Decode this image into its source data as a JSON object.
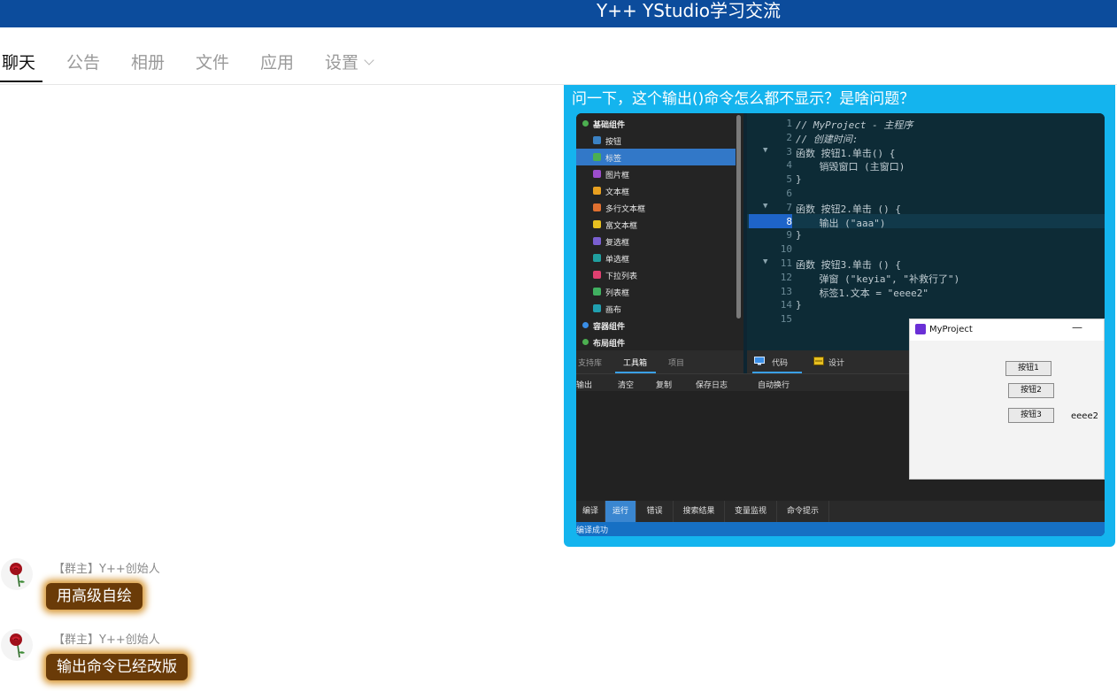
{
  "window": {
    "title": "Y++ YStudio学习交流"
  },
  "tabs": [
    {
      "label": "聊天",
      "active": true
    },
    {
      "label": "公告"
    },
    {
      "label": "相册"
    },
    {
      "label": "文件"
    },
    {
      "label": "应用"
    },
    {
      "label": "设置"
    }
  ],
  "question": {
    "text": "问一下，这个输出()命令怎么都不显示？是啥问题？",
    "screenshot": {
      "tree": [
        {
          "label": "基础组件",
          "group": true,
          "color": "#4caf50"
        },
        {
          "label": "按钮",
          "icon": "#3b82c4"
        },
        {
          "label": "标签",
          "icon": "#4caf50",
          "selected": true
        },
        {
          "label": "图片框",
          "icon": "#9c4dcc"
        },
        {
          "label": "文本框",
          "icon": "#e8a020"
        },
        {
          "label": "多行文本框",
          "icon": "#e07030"
        },
        {
          "label": "富文本框",
          "icon": "#e8c020"
        },
        {
          "label": "复选框",
          "icon": "#7a5fd0"
        },
        {
          "label": "单选框",
          "icon": "#20a0a0"
        },
        {
          "label": "下拉列表",
          "icon": "#e04070"
        },
        {
          "label": "列表框",
          "icon": "#40b060"
        },
        {
          "label": "画布",
          "icon": "#20a0b0"
        },
        {
          "label": "容器组件",
          "group": true,
          "color": "#3a8ee6"
        },
        {
          "label": "布局组件",
          "group": true,
          "color": "#4caf50"
        }
      ],
      "tree_tabs": [
        "支持库",
        "工具箱",
        "项目"
      ],
      "code_tabs": [
        "代码",
        "设计"
      ],
      "code_lines": [
        {
          "n": "1",
          "t": "// MyProject - 主程序"
        },
        {
          "n": "2",
          "t": "// 创建时间:"
        },
        {
          "n": "3",
          "t": "函数 按钮1.单击() {",
          "fold": "▼"
        },
        {
          "n": "4",
          "t": "    销毁窗口 (主窗口)"
        },
        {
          "n": "5",
          "t": "}"
        },
        {
          "n": "6",
          "t": ""
        },
        {
          "n": "7",
          "t": "函数 按钮2.单击 () {",
          "fold": "▼"
        },
        {
          "n": "8",
          "t": "    输出 (\"aaa\")",
          "current": true
        },
        {
          "n": "9",
          "t": "}"
        },
        {
          "n": "10",
          "t": ""
        },
        {
          "n": "11",
          "t": "函数 按钮3.单击 () {",
          "fold": "▼"
        },
        {
          "n": "12",
          "t": "    弹窗 (\"keyia\", \"补救行了\")"
        },
        {
          "n": "13",
          "t": "    标签1.文本 = \"eeee2\""
        },
        {
          "n": "14",
          "t": "}"
        },
        {
          "n": "15",
          "t": ""
        }
      ],
      "output_bar": [
        "输出",
        "清空",
        "复制",
        "保存日志",
        "自动换行"
      ],
      "run_window": {
        "title": "MyProject",
        "minimize": "—",
        "buttons": [
          "按钮1",
          "按钮2",
          "按钮3"
        ],
        "label": "eeee2"
      },
      "bottom_tabs": [
        "编译",
        "运行",
        "错误",
        "搜索结果",
        "变量监视",
        "命令提示"
      ],
      "status": "编译成功"
    }
  },
  "messages": [
    {
      "sender": "【群主】Y++创始人",
      "text": "用高级自绘"
    },
    {
      "sender": "【群主】Y++创始人",
      "text": "输出命令已经改版"
    }
  ],
  "colors": {
    "titlebar": "#0c4c9c",
    "bubble": "#14b4ee",
    "gold_bubble": "#6a3b08"
  }
}
